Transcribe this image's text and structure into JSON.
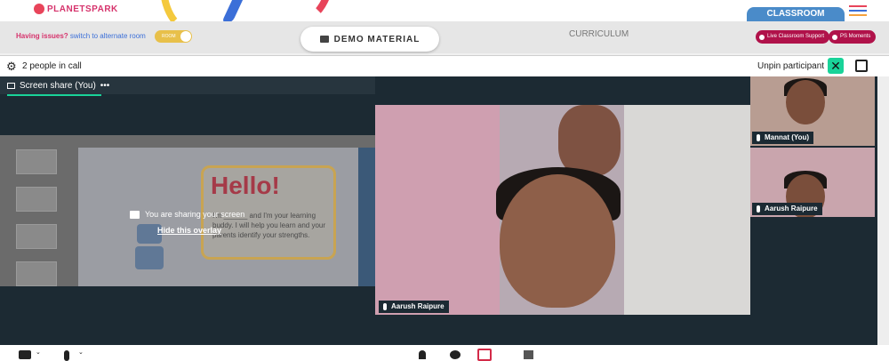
{
  "header": {
    "brand": "PLANETSPARK",
    "classroom_tab": "CLASSROOM",
    "hamburger_colors": [
      "#e8445a",
      "#3b6fd8",
      "#f4a13d"
    ]
  },
  "subheader": {
    "issue_text": "Having issues?",
    "issue_link": "switch to alternate room",
    "toggle_label": "ROOM",
    "demo_button": "DEMO MATERIAL",
    "curriculum": "CURRICULUM",
    "support_button": "Live Classroom Support",
    "moments_button": "PS Moments"
  },
  "call": {
    "people_count": "2 people in call",
    "unpin": "Unpin participant",
    "share_tab": "Screen share (You)",
    "share_menu": "•••",
    "overlay_message": "You are sharing your screen",
    "hide_overlay": "Hide this overlay",
    "slide_title": "Hello!",
    "slide_text": "I'm ______ and I'm your learning buddy. I will help you learn and your parents identify your strengths.",
    "main_participant": "Aarush Raipure",
    "participants": [
      {
        "name": "Mannat (You)"
      },
      {
        "name": "Aarush Raipure"
      }
    ]
  },
  "colors": {
    "accent_green": "#19d399",
    "brand_red": "#b0124a",
    "classroom_blue": "#4a8bc9"
  }
}
